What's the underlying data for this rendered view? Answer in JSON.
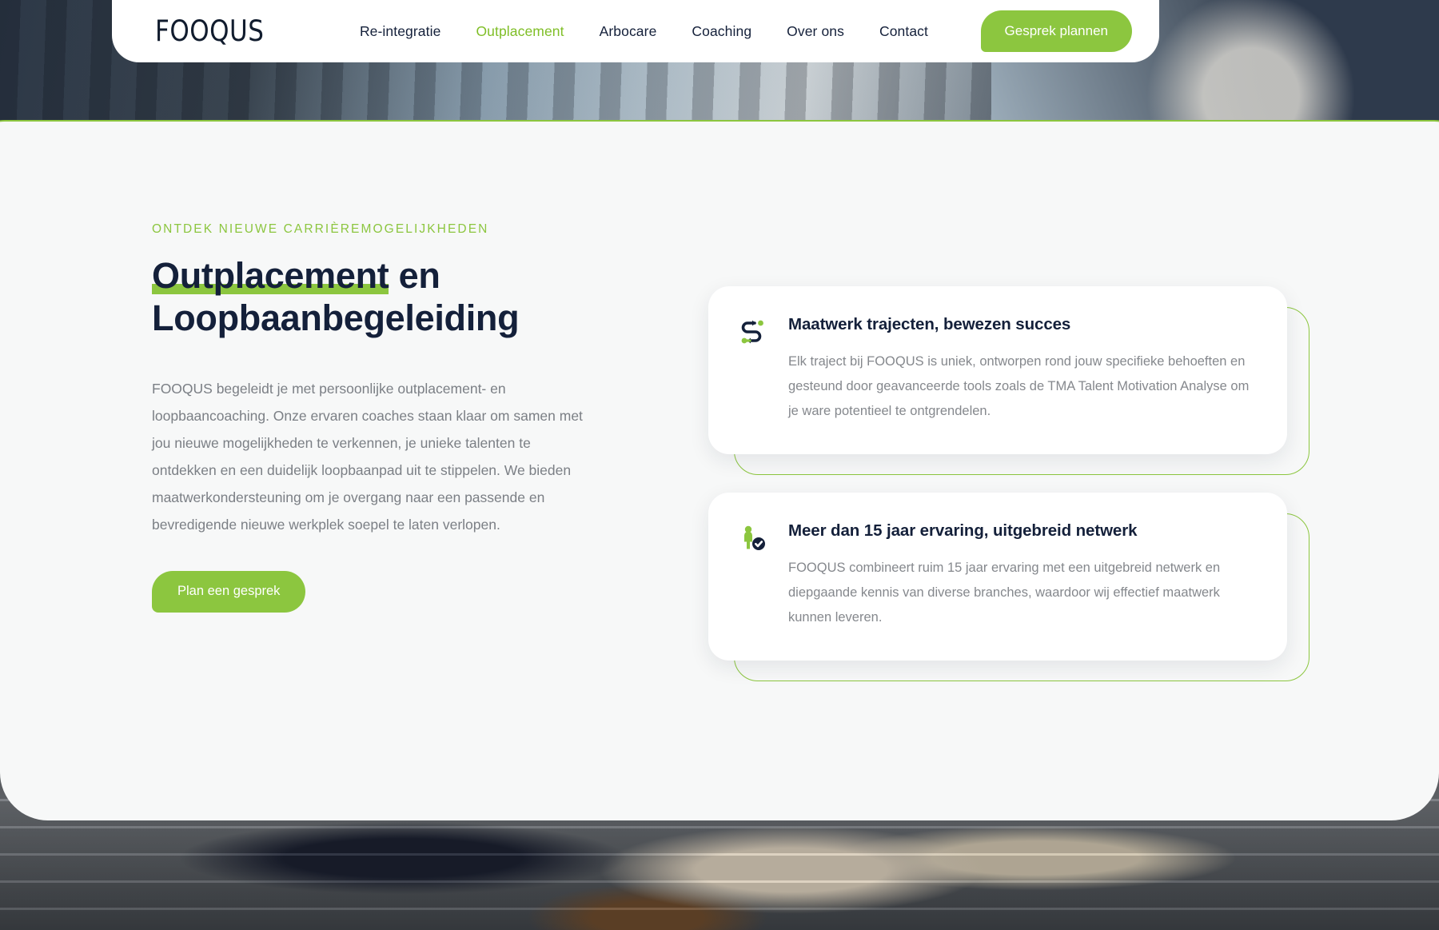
{
  "brand": {
    "logo_text": "FOOQUS",
    "accent_green": "#8cc63f",
    "dark_navy": "#14203a",
    "panel_bg": "#f7f8f8"
  },
  "nav": {
    "links": [
      {
        "label": "Re-integratie",
        "active": false
      },
      {
        "label": "Outplacement",
        "active": true
      },
      {
        "label": "Arbocare",
        "active": false
      },
      {
        "label": "Coaching",
        "active": false
      },
      {
        "label": "Over ons",
        "active": false
      },
      {
        "label": "Contact",
        "active": false
      }
    ],
    "cta_label": "Gesprek plannen"
  },
  "hero": {
    "eyebrow": "ONTDEK NIEUWE CARRIÈREMOGELIJKHEDEN",
    "title_highlight": "Outplacement",
    "title_rest": " en",
    "title_line2": "Loopbaanbegeleiding",
    "paragraph": "FOOQUS begeleidt je met persoonlijke outplacement- en loopbaancoaching. Onze ervaren coaches staan klaar om samen met jou nieuwe mogelijkheden te verkennen, je unieke talenten te ontdekken en een duidelijk loopbaanpad uit te stippelen. We bieden maatwerkondersteuning om je overgang naar een passende en bevredigende nieuwe werkplek soepel te laten verlopen.",
    "cta_label": "Plan een gesprek"
  },
  "cards": [
    {
      "icon": "route-arrows-icon",
      "title": "Maatwerk trajecten, bewezen succes",
      "text": "Elk traject bij FOOQUS is uniek, ontworpen rond jouw specifieke behoeften en gesteund door geavanceerde tools zoals de TMA Talent Motivation Analyse om je ware potentieel te ontgrendelen."
    },
    {
      "icon": "person-verified-icon",
      "title": "Meer dan 15 jaar ervaring, uitgebreid netwerk",
      "text": "FOOQUS combineert ruim 15 jaar ervaring met een uitgebreid netwerk en diepgaande kennis van diverse branches, waardoor wij effectief maatwerk kunnen leveren."
    }
  ]
}
